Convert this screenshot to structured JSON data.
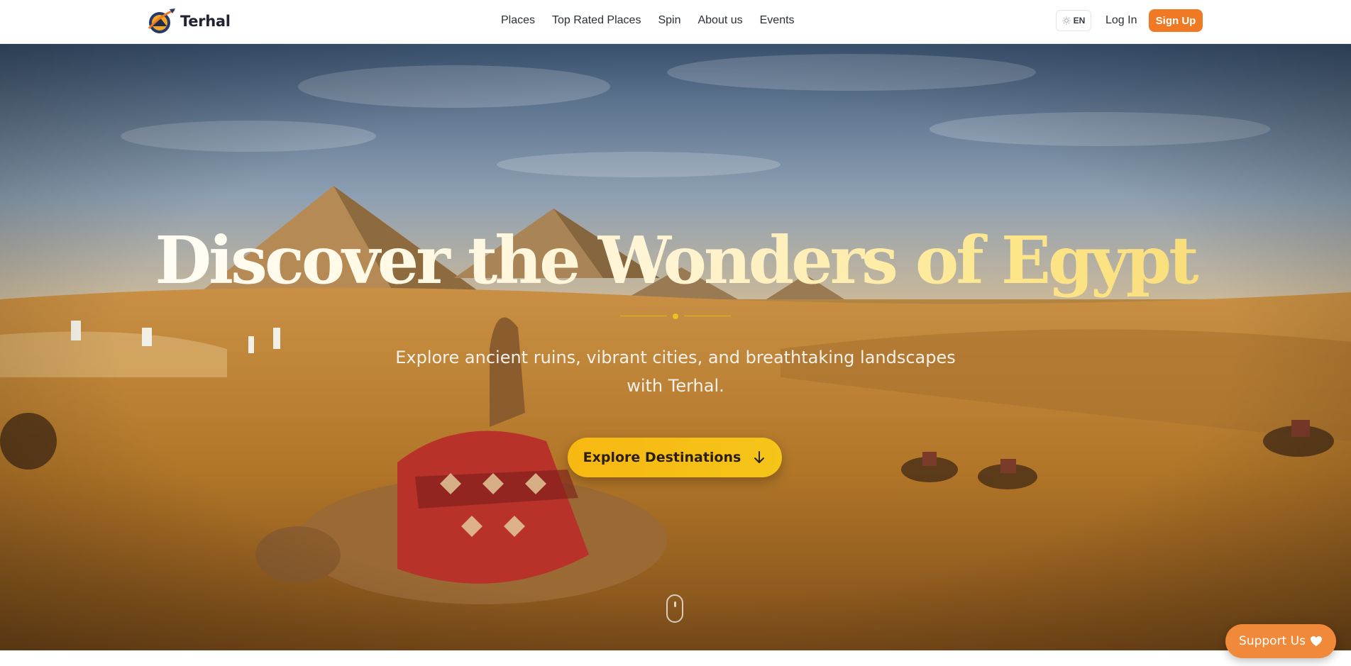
{
  "header": {
    "brand_name": "Terhal",
    "nav": [
      {
        "label": "Places"
      },
      {
        "label": "Top Rated Places"
      },
      {
        "label": "Spin"
      },
      {
        "label": "About us"
      },
      {
        "label": "Events"
      }
    ],
    "language": "EN",
    "login_label": "Log In",
    "signup_label": "Sign Up"
  },
  "hero": {
    "title": "Discover the Wonders of Egypt",
    "subtitle": "Explore ancient ruins, vibrant cities, and breathtaking landscapes with Terhal.",
    "cta_label": "Explore Destinations"
  },
  "floating": {
    "support_label": "Support Us"
  },
  "colors": {
    "accent_orange": "#f07a24",
    "cta_yellow": "#f5c518",
    "support_orange": "#f08a3a",
    "title_gold": "#fde68a"
  },
  "icons": {
    "logo": "terhal-logo-icon",
    "language": "sun-icon",
    "cta": "arrow-down-icon",
    "scroll": "mouse-scroll-icon",
    "support": "heart-icon"
  }
}
